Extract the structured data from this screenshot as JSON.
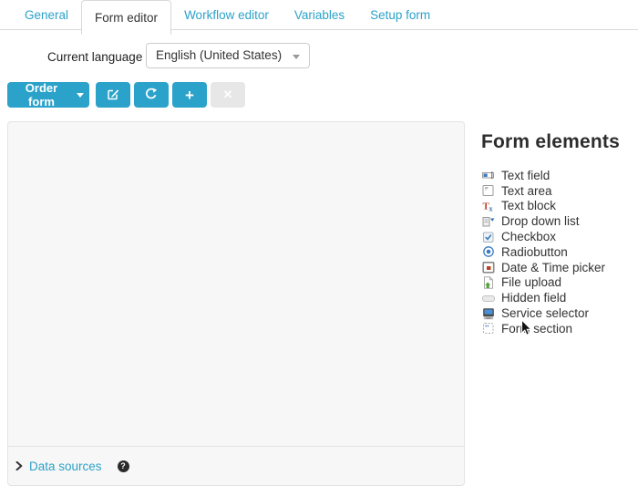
{
  "tabs": [
    {
      "label": "General",
      "active": false
    },
    {
      "label": "Form editor",
      "active": true
    },
    {
      "label": "Workflow editor",
      "active": false
    },
    {
      "label": "Variables",
      "active": false
    },
    {
      "label": "Setup form",
      "active": false
    }
  ],
  "language": {
    "label": "Current language",
    "value": "English (United States)"
  },
  "toolbar": {
    "order_form_label": "Order form",
    "edit_icon": "edit-icon",
    "refresh_icon": "refresh-icon",
    "add_glyph": "+",
    "close_glyph": "✕"
  },
  "canvas": {
    "data_sources_label": "Data sources",
    "help_glyph": "?"
  },
  "form_elements": {
    "title": "Form elements",
    "items": [
      {
        "icon": "text-field-icon",
        "label": "Text field"
      },
      {
        "icon": "text-area-icon",
        "label": "Text area"
      },
      {
        "icon": "text-block-icon",
        "label": "Text block"
      },
      {
        "icon": "drop-down-list-icon",
        "label": "Drop down list"
      },
      {
        "icon": "checkbox-icon",
        "label": "Checkbox"
      },
      {
        "icon": "radiobutton-icon",
        "label": "Radiobutton"
      },
      {
        "icon": "date-time-picker-icon",
        "label": "Date & Time picker"
      },
      {
        "icon": "file-upload-icon",
        "label": "File upload"
      },
      {
        "icon": "hidden-field-icon",
        "label": "Hidden field"
      },
      {
        "icon": "service-selector-icon",
        "label": "Service selector"
      },
      {
        "icon": "form-section-icon",
        "label": "Form section"
      }
    ]
  },
  "colors": {
    "accent": "#2ba2ca",
    "disabled_button_bg": "#e7e7e7",
    "panel_bg": "#f7f7f7",
    "panel_border": "#e3e3e3"
  }
}
